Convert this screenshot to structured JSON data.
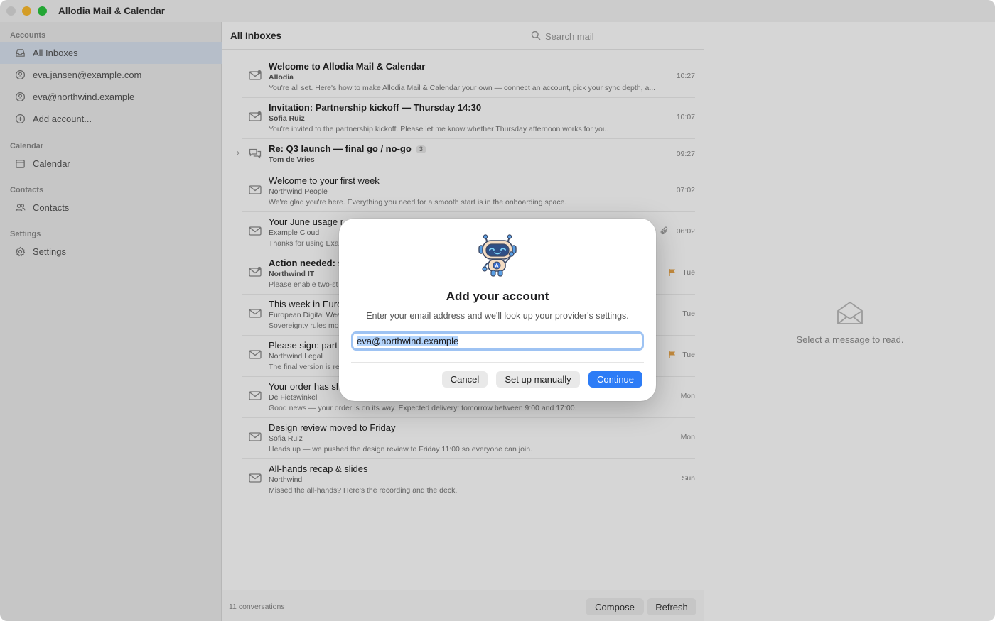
{
  "window": {
    "title": "Allodia Mail & Calendar"
  },
  "sidebar": {
    "sections": [
      {
        "label": "Accounts"
      },
      {
        "label": "Calendar"
      },
      {
        "label": "Contacts"
      },
      {
        "label": "Settings"
      }
    ],
    "items": [
      {
        "label": "All Inboxes",
        "icon": "inbox-tray-icon",
        "active": true
      },
      {
        "label": "eva.jansen@example.com",
        "icon": "person-circle-icon"
      },
      {
        "label": "eva@northwind.example",
        "icon": "person-circle-icon"
      },
      {
        "label": "Add account...",
        "icon": "plus-circle-icon"
      },
      {
        "label": "Calendar",
        "icon": "calendar-icon"
      },
      {
        "label": "Contacts",
        "icon": "people-icon"
      },
      {
        "label": "Settings",
        "icon": "gear-icon"
      }
    ]
  },
  "list": {
    "title": "All Inboxes",
    "search_placeholder": "Search mail",
    "messages": [
      {
        "subject": "Welcome to Allodia Mail & Calendar",
        "sender": "Allodia",
        "preview": "You're all set. Here's how to make Allodia Mail & Calendar your own — connect an account, pick your sync depth, a...",
        "time": "10:27",
        "unread": true
      },
      {
        "subject": "Invitation: Partnership kickoff — Thursday 14:30",
        "sender": "Sofia Ruiz",
        "preview": "You're invited to the partnership kickoff. Please let me know whether Thursday afternoon works for you.",
        "time": "10:07",
        "unread": true
      },
      {
        "subject": "Re: Q3 launch — final go / no-go",
        "sender": "Tom de Vries",
        "preview": "",
        "time": "09:27",
        "unread": true,
        "thread_count": "3"
      },
      {
        "subject": "Welcome to your first week",
        "sender": "Northwind People",
        "preview": "We're glad you're here. Everything you need for a smooth start is in the onboarding space.",
        "time": "07:02"
      },
      {
        "subject": "Your June usage r",
        "sender": "Example Cloud",
        "preview": "Thanks for using Exa",
        "time": "06:02",
        "attachment": true
      },
      {
        "subject": "Action needed: s",
        "sender": "Northwind IT",
        "preview": "Please enable two-st",
        "time": "Tue",
        "unread": true,
        "flagged": true
      },
      {
        "subject": "This week in Euro",
        "sender": "European Digital Wee",
        "preview": "Sovereignty rules mo",
        "time": "Tue"
      },
      {
        "subject": "Please sign: part",
        "sender": "Northwind Legal",
        "preview": "The final version is re",
        "time": "Tue",
        "flagged": true
      },
      {
        "subject": "Your order has sh",
        "sender": "De Fietswinkel",
        "preview": "Good news — your order is on its way. Expected delivery: tomorrow between 9:00 and 17:00.",
        "time": "Mon"
      },
      {
        "subject": "Design review moved to Friday",
        "sender": "Sofia Ruiz",
        "preview": "Heads up — we pushed the design review to Friday 11:00 so everyone can join.",
        "time": "Mon"
      },
      {
        "subject": "All-hands recap & slides",
        "sender": "Northwind",
        "preview": "Missed the all-hands? Here's the recording and the deck.",
        "time": "Sun"
      }
    ],
    "footer": {
      "count_label": "11 conversations",
      "compose_label": "Compose",
      "refresh_label": "Refresh"
    }
  },
  "reading_pane": {
    "empty_text": "Select a message to read."
  },
  "dialog": {
    "title": "Add your account",
    "subtitle": "Enter your email address and we'll look up your provider's settings.",
    "email_value": "eva@northwind.example",
    "cancel_label": "Cancel",
    "manual_label": "Set up manually",
    "continue_label": "Continue"
  },
  "colors": {
    "accent": "#2d7cf6",
    "flag": "#e8a54a",
    "sidebar_bg": "#ececec",
    "sidebar_active": "#d9e3f0"
  }
}
